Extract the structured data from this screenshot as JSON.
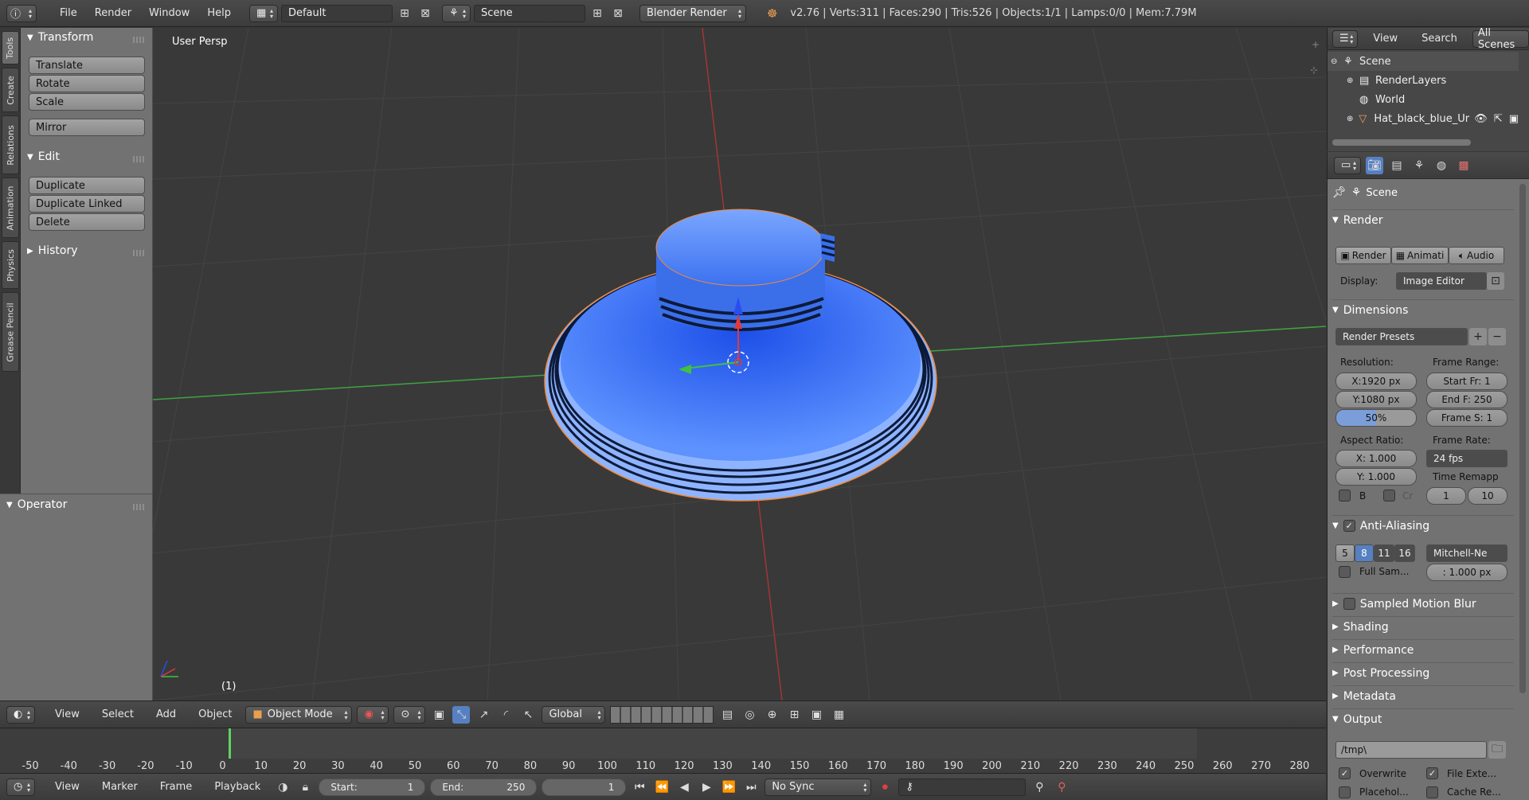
{
  "top_header": {
    "menus": [
      "File",
      "Render",
      "Window",
      "Help"
    ],
    "layout": "Default",
    "scene": "Scene",
    "engine": "Blender Render",
    "stats": "v2.76 | Verts:311 | Faces:290 | Tris:526 | Objects:1/1 | Lamps:0/0 | Mem:7.79M"
  },
  "side_tabs": [
    "Tools",
    "Create",
    "Relations",
    "Animation",
    "Physics",
    "Grease Pencil"
  ],
  "tool_shelf": {
    "transform_title": "Transform",
    "transform_buttons": [
      "Translate",
      "Rotate",
      "Scale"
    ],
    "mirror": "Mirror",
    "edit_title": "Edit",
    "edit_buttons": [
      "Duplicate",
      "Duplicate Linked",
      "Delete"
    ],
    "history_title": "History",
    "operator_title": "Operator"
  },
  "viewport": {
    "view_label": "User Persp",
    "frame_label": "(1)",
    "colors": {
      "hat": "#2f6cf2",
      "hat_light": "#8ab2ff",
      "outline": "#f08a3a"
    }
  },
  "viewport_header": {
    "menus": [
      "View",
      "Select",
      "Add",
      "Object"
    ],
    "mode": "Object Mode",
    "orientation": "Global"
  },
  "timeline": {
    "ticks": [
      "-50",
      "-40",
      "-30",
      "-20",
      "-10",
      "0",
      "10",
      "20",
      "30",
      "40",
      "50",
      "60",
      "70",
      "80",
      "90",
      "100",
      "110",
      "120",
      "130",
      "140",
      "150",
      "160",
      "170",
      "180",
      "190",
      "200",
      "210",
      "220",
      "230",
      "240",
      "250",
      "260",
      "270",
      "280"
    ],
    "current_frame": 1
  },
  "timeline_header": {
    "menus": [
      "View",
      "Marker",
      "Frame",
      "Playback"
    ],
    "start": "Start:",
    "start_val": "1",
    "end": "End:",
    "end_val": "250",
    "current": "1",
    "sync": "No Sync"
  },
  "outliner": {
    "menus": [
      "View",
      "Search"
    ],
    "filter": "All Scenes",
    "items": [
      "Scene",
      "RenderLayers",
      "World",
      "Hat_black_blue_Ur"
    ]
  },
  "properties": {
    "context": "Scene",
    "render_title": "Render",
    "render_buttons": [
      "Render",
      "Animati",
      "Audio"
    ],
    "display_label": "Display:",
    "display_value": "Image Editor",
    "dimensions_title": "Dimensions",
    "presets": "Render Presets",
    "resolution_label": "Resolution:",
    "res_x": "X:1920 px",
    "res_y": "Y:1080 px",
    "res_pct": "50%",
    "frame_range_label": "Frame Range:",
    "start_fr": "Start Fr: 1",
    "end_f": "End F: 250",
    "frame_s": "Frame S: 1",
    "aspect_label": "Aspect Ratio:",
    "aspect_x": "X:   1.000",
    "aspect_y": "Y:   1.000",
    "frame_rate_label": "Frame Rate:",
    "fps": "24 fps",
    "time_remap_label": "Time Remapp",
    "remap_old": "1",
    "remap_new": "10",
    "b_label": "B",
    "cr_label": "Cr",
    "aa_title": "Anti-Aliasing",
    "aa_samples": [
      "5",
      "8",
      "11",
      "16"
    ],
    "aa_filter": "Mitchell-Ne",
    "full_sample": "Full Sam...",
    "filter_size": ": 1.000 px",
    "collapsed_sections": [
      "Sampled Motion Blur",
      "Shading",
      "Performance",
      "Post Processing",
      "Metadata"
    ],
    "output_title": "Output",
    "output_path": "/tmp\\",
    "overwrite": "Overwrite",
    "file_ext": "File Exte...",
    "placeholders": "Placehol...",
    "cache_re": "Cache Re..."
  }
}
